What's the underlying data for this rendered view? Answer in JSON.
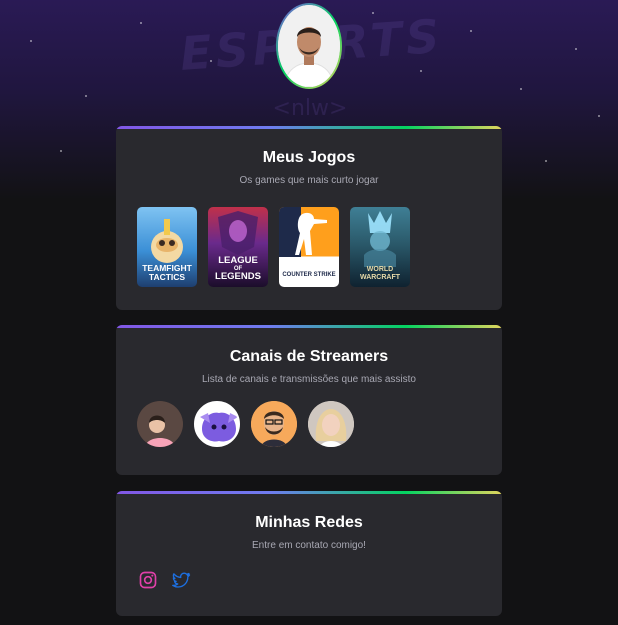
{
  "hero": {
    "title": "ESPORTS",
    "subtitle": "<nlw>"
  },
  "profile": {
    "avatar_icon": "profile-photo"
  },
  "games_section": {
    "title": "Meus Jogos",
    "subtitle": "Os games que mais curto jogar",
    "games": [
      {
        "label_line1": "TEAMFIGHT",
        "label_line2": "TACTICS",
        "color": "#3b8fd6"
      },
      {
        "label_line1": "LEAGUE",
        "label_line2": "LEGENDS",
        "label_mid": "OF",
        "color": "#6a2a8c"
      },
      {
        "label": "COUNTER STRIKE",
        "color": "#ff9f1c"
      },
      {
        "label_line1": "WORLD",
        "label_line2": "WARCRAFT",
        "color": "#2b5a6b"
      }
    ]
  },
  "streamers_section": {
    "title": "Canais de Streamers",
    "subtitle": "Lista de canais e transmissões que mais assisto",
    "streamers": [
      {
        "icon": "streamer-1-avatar"
      },
      {
        "icon": "streamer-2-avatar"
      },
      {
        "icon": "streamer-3-avatar"
      },
      {
        "icon": "streamer-4-avatar"
      }
    ]
  },
  "social_section": {
    "title": "Minhas Redes",
    "subtitle": "Entre em contato comigo!",
    "links": [
      {
        "icon": "instagram-icon",
        "color": "#e040a8"
      },
      {
        "icon": "twitter-icon",
        "color": "#1d6fe0"
      }
    ]
  }
}
